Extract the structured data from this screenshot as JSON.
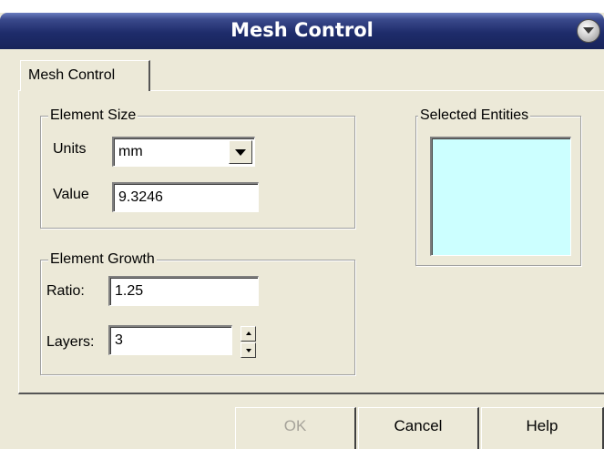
{
  "window": {
    "title": "Mesh Control"
  },
  "tabs": [
    {
      "label": "Mesh Control"
    }
  ],
  "element_size": {
    "title": "Element Size",
    "units_label": "Units",
    "units_value": "mm",
    "value_label": "Value",
    "value_value": "9.3246"
  },
  "element_growth": {
    "title": "Element Growth",
    "ratio_label": "Ratio:",
    "ratio_value": "1.25",
    "layers_label": "Layers:",
    "layers_value": "3"
  },
  "selected_entities": {
    "title": "Selected Entities"
  },
  "buttons": {
    "ok": "OK",
    "cancel": "Cancel",
    "help": "Help"
  },
  "colors": {
    "listbox_bg": "#ccffff",
    "titlebar": "#1e2c6b"
  },
  "icons": {
    "title_button": "chevron-down-circle-icon",
    "combo": "dropdown-arrow-icon",
    "spin_up": "spin-up-icon",
    "spin_down": "spin-down-icon"
  }
}
